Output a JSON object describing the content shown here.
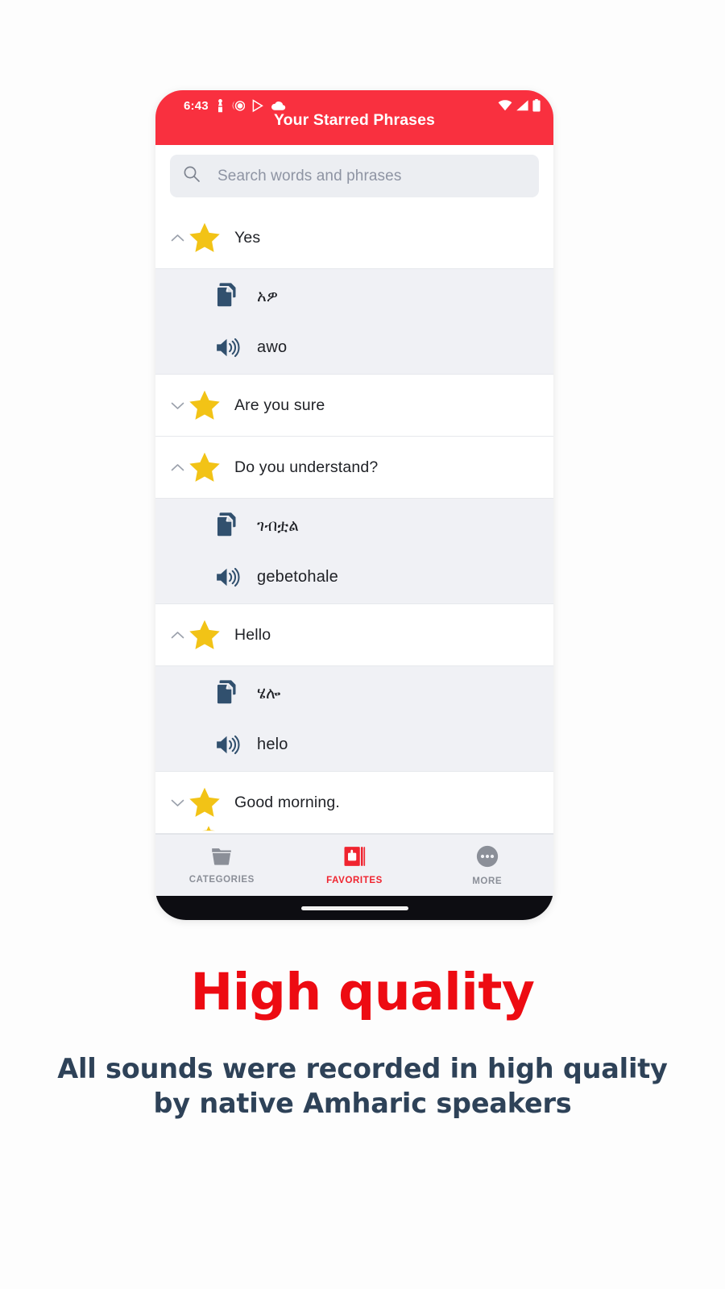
{
  "status_bar": {
    "time": "6:43",
    "left_icons": [
      "person-notification-icon",
      "clock-alarm-icon",
      "play-store-icon",
      "cloud-icon"
    ],
    "right_icons": [
      "wifi-icon",
      "signal-icon",
      "battery-icon"
    ]
  },
  "app_bar": {
    "title": "Your Starred Phrases",
    "background_color": "#F9303F"
  },
  "search": {
    "placeholder": "Search words and phrases",
    "icon": "search-icon"
  },
  "phrases": [
    {
      "label": "Yes",
      "expanded": true,
      "chevron": "chevron-up-icon",
      "native": "አዎ",
      "transliteration": "awo"
    },
    {
      "label": "Are you sure",
      "expanded": false,
      "chevron": "chevron-down-icon",
      "native": "",
      "transliteration": ""
    },
    {
      "label": "Do you understand?",
      "expanded": true,
      "chevron": "chevron-up-icon",
      "native": "ገብቷል",
      "transliteration": "gebetohale"
    },
    {
      "label": "Hello",
      "expanded": true,
      "chevron": "chevron-up-icon",
      "native": "ሄሎ",
      "transliteration": "helo"
    },
    {
      "label": "Good morning.",
      "expanded": false,
      "chevron": "chevron-down-icon",
      "native": "",
      "transliteration": ""
    }
  ],
  "icons": {
    "star": "star-icon",
    "copy": "copy-icon",
    "speaker": "speaker-icon"
  },
  "bottom_nav": {
    "items": [
      {
        "label": "CATEGORIES",
        "icon": "folder-icon",
        "active": false
      },
      {
        "label": "FAVORITES",
        "icon": "favorites-book-icon",
        "active": true
      },
      {
        "label": "MORE",
        "icon": "more-dots-icon",
        "active": false
      }
    ],
    "active_color": "#F0242F",
    "inactive_color": "#8b8f98"
  },
  "promo": {
    "title": "High quality",
    "title_color": "#ED0B12",
    "subtitle_line1": "All sounds were recorded in high quality",
    "subtitle_line2": "by native Amharic speakers",
    "subtitle_color": "#2e4258"
  }
}
